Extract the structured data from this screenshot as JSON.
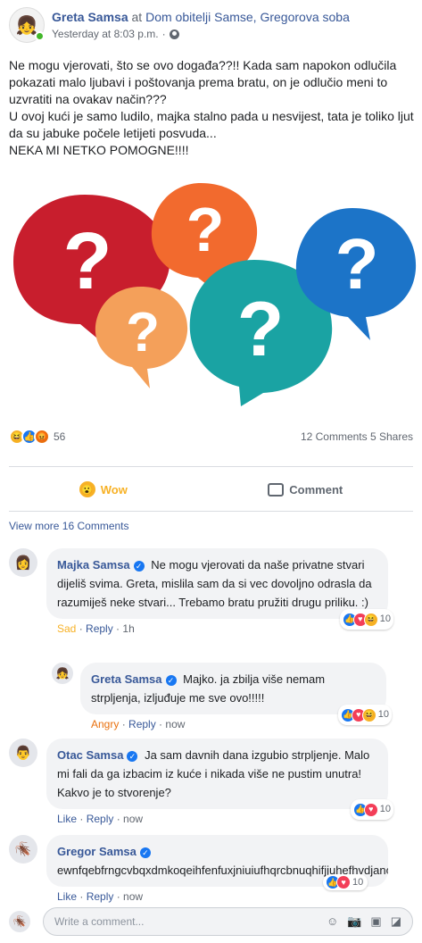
{
  "post": {
    "author": "Greta Samsa",
    "at_label": "at",
    "location": "Dom obitelji Samse, Gregorova soba",
    "time": "Yesterday at 8:03 p.m.",
    "separator": "·",
    "text": "Ne mogu vjerovati, što se ovo događa??!! Kada sam napokon odlučila pokazati malo ljubavi i poštovanja prema bratu, on je odlučio meni to uzvratiti na ovakav način???\nU ovoj kući je samo ludilo, majka stalno pada u nesvijest, tata je toliko ljut da su jabuke počele letijeti posvuda...\nNEKA MI NETKO POMOGNE!!!!",
    "image_colors": [
      "#c81e2d",
      "#f26a2e",
      "#f4a05a",
      "#1aa3a3",
      "#1c74c8"
    ]
  },
  "stats": {
    "reaction_count": "56",
    "comments_shares": "12 Comments 5 Shares"
  },
  "actions": {
    "wow_label": "Wow",
    "comment_label": "Comment"
  },
  "view_more": "View more 16 Comments",
  "comments": [
    {
      "name": "Majka Samsa",
      "text": "Ne mogu vjerovati da naše privatne stvari dijeliš svima. Greta, mislila sam da si vec dovoljno odrasla da razumiješ neke stvari... Trebamo bratu pružiti drugu priliku. :)",
      "reaction": "Sad",
      "reply": "Reply",
      "time": "1h",
      "count": "10"
    },
    {
      "name": "Greta Samsa",
      "text": "Majko. ja zbilja više nemam strpljenja, izljuđuje me sve ovo!!!!!",
      "reaction": "Angry",
      "reply": "Reply",
      "time": "now",
      "count": "10"
    },
    {
      "name": "Otac Samsa",
      "text": "Ja sam davnih dana izgubio strpljenje. Malo mi fali da ga izbacim iz kuće i nikada više ne pustim unutra! Kakvo je to stvorenje?",
      "reaction": "Like",
      "reply": "Reply",
      "time": "now",
      "count": "10"
    },
    {
      "name": "Gregor Samsa",
      "text": "ewnfqebfrngcvbqxdmkoqeihfenfuxjniuiufhqrcbnuqhifjjuhefhvdjanćxn",
      "reaction": "Like",
      "reply": "Reply",
      "time": "now",
      "count": "10"
    }
  ],
  "write_comment_placeholder": "Write a comment..."
}
